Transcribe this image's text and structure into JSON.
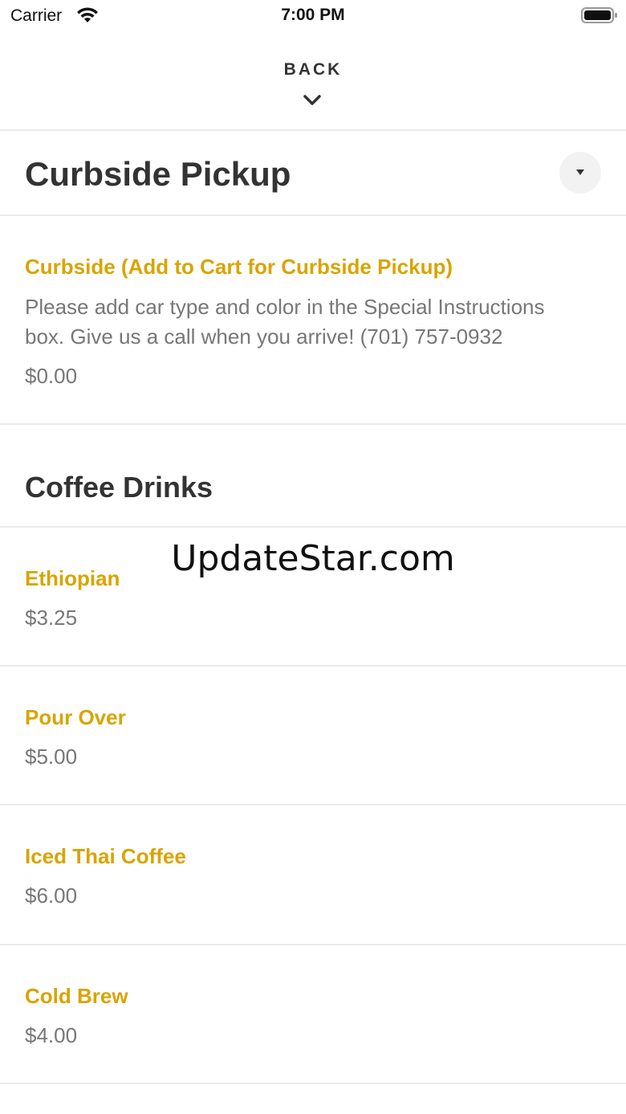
{
  "status_bar": {
    "carrier": "Carrier",
    "time": "7:00 PM",
    "wifi_icon": "wifi-icon",
    "battery_icon": "battery-icon"
  },
  "nav": {
    "back_label": "BACK",
    "back_icon": "chevron-down-icon"
  },
  "sections": [
    {
      "title": "Curbside Pickup",
      "collapse_icon": "caret-down-icon",
      "items": [
        {
          "name": "Curbside (Add to Cart for Curbside Pickup)",
          "description": "Please add car type and color in the Special Instructions box. Give us a call when you arrive! (701) 757-0932",
          "price": "$0.00"
        }
      ]
    },
    {
      "title": "Coffee Drinks",
      "items": [
        {
          "name": "Ethiopian",
          "price": "$3.25"
        },
        {
          "name": "Pour Over",
          "price": "$5.00"
        },
        {
          "name": "Iced Thai Coffee",
          "price": "$6.00"
        },
        {
          "name": "Cold Brew",
          "price": "$4.00"
        }
      ]
    }
  ],
  "watermark": "UpdateStar.com",
  "colors": {
    "item_name": "#d9a400",
    "secondary_text": "#777777",
    "divider": "#ebebeb"
  }
}
